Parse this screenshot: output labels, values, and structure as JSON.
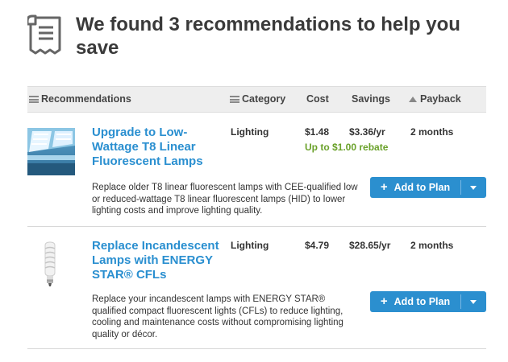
{
  "header": {
    "icon": "document-list-icon",
    "title": "We found 3 recommendations to help you save"
  },
  "table": {
    "columns": {
      "recommendations": "Recommendations",
      "category": "Category",
      "cost": "Cost",
      "savings": "Savings",
      "payback": "Payback"
    },
    "rows": [
      {
        "image": "fluorescent-lamps-thumbnail",
        "title": "Upgrade to Low-Wattage T8 Linear Fluorescent Lamps",
        "category": "Lighting",
        "cost": "$1.48",
        "savings": "$3.36/yr",
        "payback": "2 months",
        "rebate": "Up to $1.00 rebate",
        "description": "Replace older T8 linear fluorescent lamps with CEE-qualified low or reduced-wattage T8 linear fluorescent lamps (HID) to lower lighting costs and improve lighting quality.",
        "button_plus": "+",
        "button_label": "Add to Plan"
      },
      {
        "image": "cfl-bulb-thumbnail",
        "title": "Replace Incandescent Lamps with ENERGY STAR® CFLs",
        "category": "Lighting",
        "cost": "$4.79",
        "savings": "$28.65/yr",
        "payback": "2 months",
        "description": "Replace your incandescent lamps with ENERGY STAR® qualified compact fluorescent lights (CFLs) to reduce lighting, cooling and maintenance costs without compromising lighting quality or décor.",
        "button_plus": "+",
        "button_label": "Add to Plan"
      }
    ]
  },
  "colors": {
    "link": "#2a8fd0",
    "rebate": "#6aa12a",
    "button": "#2b8fcf",
    "header_bg": "#eeeeee"
  }
}
